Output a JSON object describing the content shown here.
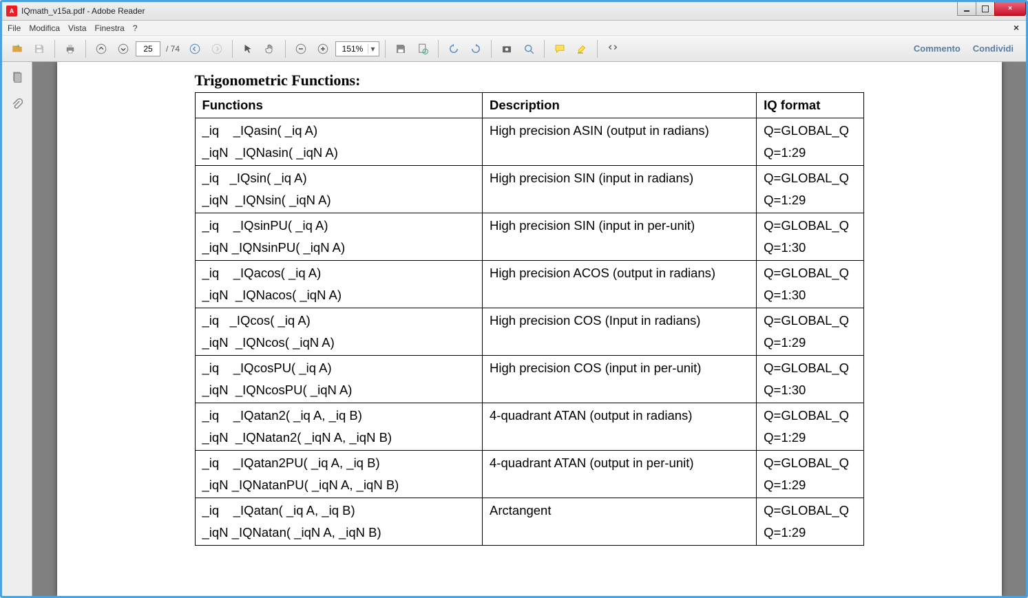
{
  "window": {
    "title": "IQmath_v15a.pdf - Adobe Reader",
    "close_label": "×"
  },
  "menu": {
    "items": [
      "File",
      "Modifica",
      "Vista",
      "Finestra",
      "?"
    ]
  },
  "toolbar": {
    "page_current": "25",
    "page_total": "/ 74",
    "zoom": "151%",
    "commento": "Commento",
    "condividi": "Condividi"
  },
  "doc": {
    "section_title": "Trigonometric Functions:",
    "headers": {
      "functions": "Functions",
      "description": "Description",
      "iqformat": "IQ format"
    },
    "rows": [
      {
        "f1": "_iq    _IQasin( _iq A)",
        "f2": "_iqN  _IQNasin( _iqN A)",
        "desc": "High precision ASIN (output in radians)",
        "q1": "Q=GLOBAL_Q",
        "q2": "Q=1:29"
      },
      {
        "f1": "_iq   _IQsin( _iq A)",
        "f2": "_iqN  _IQNsin( _iqN A)",
        "desc": "High precision SIN (input in radians)",
        "q1": "Q=GLOBAL_Q",
        "q2": "Q=1:29"
      },
      {
        "f1": "_iq    _IQsinPU( _iq A)",
        "f2": "_iqN _IQNsinPU( _iqN A)",
        "desc": "High precision SIN (input in per-unit)",
        "q1": "Q=GLOBAL_Q",
        "q2": "Q=1:30"
      },
      {
        "f1": "_iq    _IQacos( _iq A)",
        "f2": "_iqN  _IQNacos( _iqN A)",
        "desc": "High precision ACOS (output in radians)",
        "q1": "Q=GLOBAL_Q",
        "q2": "Q=1:30"
      },
      {
        "f1": "_iq   _IQcos( _iq A)",
        "f2": "_iqN  _IQNcos( _iqN A)",
        "desc": "High precision COS (Input in radians)",
        "q1": "Q=GLOBAL_Q",
        "q2": "Q=1:29"
      },
      {
        "f1": "_iq    _IQcosPU( _iq A)",
        "f2": "_iqN  _IQNcosPU( _iqN A)",
        "desc": "High precision COS (input in per-unit)",
        "q1": "Q=GLOBAL_Q",
        "q2": "Q=1:30"
      },
      {
        "f1": "_iq    _IQatan2( _iq A, _iq B)",
        "f2": "_iqN  _IQNatan2( _iqN A, _iqN B)",
        "desc": "4-quadrant ATAN (output in radians)",
        "q1": "Q=GLOBAL_Q",
        "q2": "Q=1:29"
      },
      {
        "f1": "_iq    _IQatan2PU( _iq A, _iq B)",
        "f2": "_iqN _IQNatanPU( _iqN A, _iqN B)",
        "desc": "4-quadrant ATAN (output in per-unit)",
        "q1": "Q=GLOBAL_Q",
        "q2": "Q=1:29"
      },
      {
        "f1": "_iq    _IQatan( _iq A, _iq B)",
        "f2": "_iqN _IQNatan( _iqN A, _iqN B)",
        "desc": "Arctangent",
        "q1": "Q=GLOBAL_Q",
        "q2": "Q=1:29"
      }
    ]
  }
}
